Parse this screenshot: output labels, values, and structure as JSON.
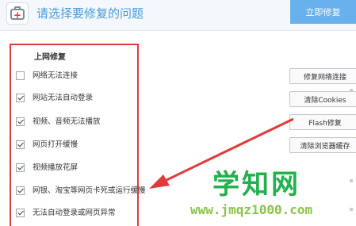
{
  "header": {
    "title": "请选择要修复的问题",
    "repair_now_label": "立即修复",
    "accent_color": "#68b1ec"
  },
  "section": {
    "title": "上网修复",
    "items": [
      {
        "label": "网络无法连接",
        "checked": false
      },
      {
        "label": "网站无法自动登录",
        "checked": true
      },
      {
        "label": "视频、音频无法播放",
        "checked": true
      },
      {
        "label": "网页打开缓慢",
        "checked": true
      },
      {
        "label": "视频播放花屏",
        "checked": true
      },
      {
        "label": "网银、淘宝等网页卡死或运行缓慢",
        "checked": true
      },
      {
        "label": "无法自动登录或网页异常",
        "checked": true
      }
    ]
  },
  "side_buttons": [
    {
      "label": "修复网络连接"
    },
    {
      "label": "清除Cookies"
    },
    {
      "label": "Flash修复"
    },
    {
      "label": "清除浏览器缓存"
    }
  ],
  "watermark": {
    "text": "学知网",
    "url": "www.jmqz1000.com"
  },
  "highlight_color": "#e03b3b"
}
